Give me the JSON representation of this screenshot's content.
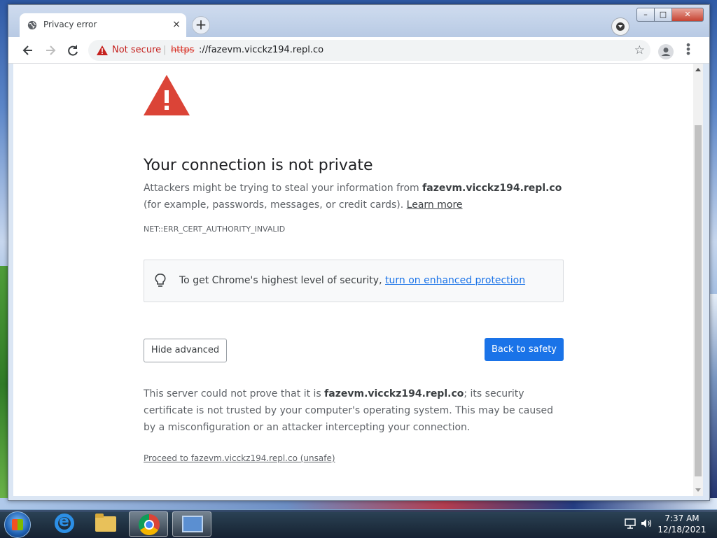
{
  "browser": {
    "tab": {
      "title": "Privacy error",
      "close": "×"
    },
    "new_tab_label": "+",
    "window_buttons": {
      "minimize": "–",
      "maximize": "□",
      "close": "✕"
    },
    "address": {
      "security_label": "Not secure",
      "separator": "|",
      "scheme": "https",
      "rest": "://fazevm.vicckz194.repl.co",
      "bookmark_icon": "star-icon"
    },
    "menu_label": "⋮"
  },
  "page": {
    "heading": "Your connection is not private",
    "para1_prefix": "Attackers might be trying to steal your information from ",
    "para1_host": "fazevm.vicckz194.repl.co",
    "para1_suffix": " (for example, passwords, messages, or credit cards). ",
    "learn_more": "Learn more",
    "error_code": "NET::ERR_CERT_AUTHORITY_INVALID",
    "security_box": {
      "text": "To get Chrome's highest level of security, ",
      "link": "turn on enhanced protection"
    },
    "buttons": {
      "hide_advanced": "Hide advanced",
      "back_to_safety": "Back to safety"
    },
    "para2_prefix": "This server could not prove that it is ",
    "para2_host": "fazevm.vicckz194.repl.co",
    "para2_suffix": "; its security certificate is not trusted by your computer's operating system. This may be caused by a misconfiguration or an attacker intercepting your connection.",
    "proceed_link": "Proceed to fazevm.vicckz194.repl.co (unsafe)"
  },
  "taskbar": {
    "time": "7:37 AM",
    "date": "12/18/2021",
    "apps": [
      "internet-explorer",
      "file-explorer",
      "chrome",
      "remote-desktop"
    ]
  },
  "colors": {
    "accent": "#1a73e8",
    "warning": "#d93025",
    "text": "#202124"
  }
}
